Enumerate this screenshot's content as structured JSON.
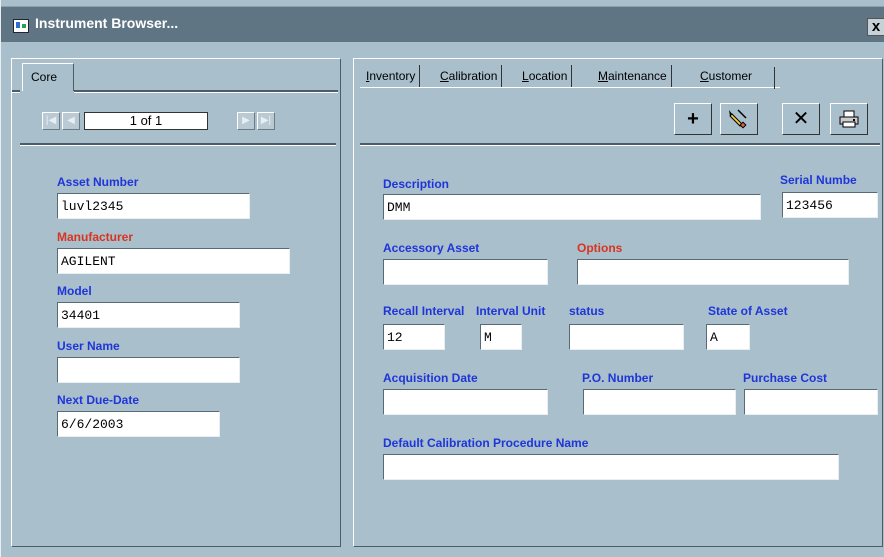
{
  "window": {
    "title": "Instrument Browser...",
    "close_glyph": "x"
  },
  "left": {
    "tab": "Core",
    "nav": {
      "first": "|◀",
      "prev": "◀",
      "record": "1 of 1",
      "next": "▶",
      "last": "▶|"
    },
    "fields": {
      "asset_number": {
        "label": "Asset Number",
        "value": "luvl2345"
      },
      "manufacturer": {
        "label": "Manufacturer",
        "value": "AGILENT"
      },
      "model": {
        "label": "Model",
        "value": "34401"
      },
      "user_name": {
        "label": "User Name",
        "value": ""
      },
      "next_due_date": {
        "label": "Next Due-Date",
        "value": "6/6/2003"
      }
    }
  },
  "right": {
    "tabs": [
      {
        "key": "I",
        "rest": "nventory"
      },
      {
        "key": "C",
        "rest": "alibration"
      },
      {
        "key": "L",
        "rest": "ocation"
      },
      {
        "key": "M",
        "rest": "aintenance"
      },
      {
        "key": "C",
        "rest": "ustomer"
      }
    ],
    "toolbar": {
      "add": "+",
      "edit_icon": "pencil-icon",
      "delete": "✕",
      "print_icon": "printer-icon"
    },
    "fields": {
      "description": {
        "label": "Description",
        "value": "DMM"
      },
      "serial_number": {
        "label": "Serial Numbe",
        "value": "123456"
      },
      "accessory_asset": {
        "label": "Accessory Asset",
        "value": ""
      },
      "options": {
        "label": "Options",
        "value": ""
      },
      "recall_interval": {
        "label": "Recall Interval",
        "value": "12"
      },
      "interval_unit": {
        "label": "Interval Unit",
        "value": "M"
      },
      "status": {
        "label": "status",
        "value": ""
      },
      "state_of_asset": {
        "label": "State of Asset",
        "value": "A"
      },
      "acquisition_date": {
        "label": "Acquisition Date",
        "value": ""
      },
      "po_number": {
        "label": "P.O. Number",
        "value": ""
      },
      "purchase_cost": {
        "label": "Purchase Cost",
        "value": ""
      },
      "default_procedure": {
        "label": "Default Calibration Procedure Name",
        "value": ""
      }
    }
  },
  "colors": {
    "background": "#a9bfcc",
    "titlebar": "#5f7584",
    "label_blue": "#1f35d8",
    "label_red": "#d8341f"
  }
}
